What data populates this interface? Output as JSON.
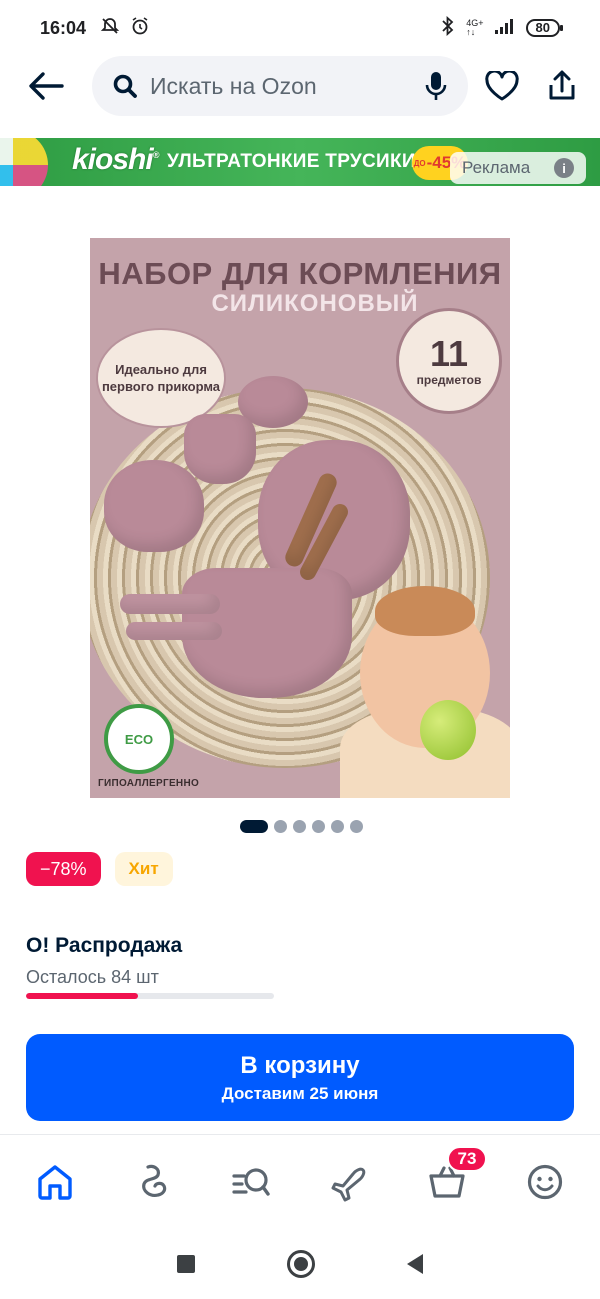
{
  "status_bar": {
    "time": "16:04",
    "network": "4G+",
    "battery": "80"
  },
  "top_bar": {
    "search_placeholder": "Искать на Ozon"
  },
  "ad_banner": {
    "brand": "kioshi",
    "brand_mark": "®",
    "text": "УЛЬТРАТОНКИЕ ТРУСИКИ",
    "discount_prefix": "ДО",
    "discount": "-45%",
    "label": "Реклама",
    "info_icon": "i"
  },
  "product_image": {
    "title": "НАБОР ДЛЯ КОРМЛЕНИЯ",
    "subtitle": "СИЛИКОНОВЫЙ",
    "bubble_text": "Идеально для первого прикорма",
    "count_number": "11",
    "count_word": "предметов",
    "eco_label": "ECO",
    "eco_caption": "ГИПОАЛЛЕРГЕННО",
    "accent_color": "#c4a3aa"
  },
  "gallery": {
    "total_pages": 6,
    "current_page": 1
  },
  "badges": {
    "discount": "−78%",
    "hit": "Хит"
  },
  "sale": {
    "title": "О! Распродажа",
    "stock_text": "Осталось 84 шт",
    "progress_percent": 45
  },
  "cart_button": {
    "label": "В корзину",
    "delivery": "Доставим 25 июня",
    "color": "#005bff"
  },
  "bottom_nav": {
    "items": [
      {
        "icon": "home-icon",
        "active": true
      },
      {
        "icon": "fresh-icon"
      },
      {
        "icon": "catalog-search-icon"
      },
      {
        "icon": "travel-plane-icon"
      },
      {
        "icon": "cart-icon",
        "badge": "73"
      },
      {
        "icon": "profile-smile-icon"
      }
    ]
  }
}
